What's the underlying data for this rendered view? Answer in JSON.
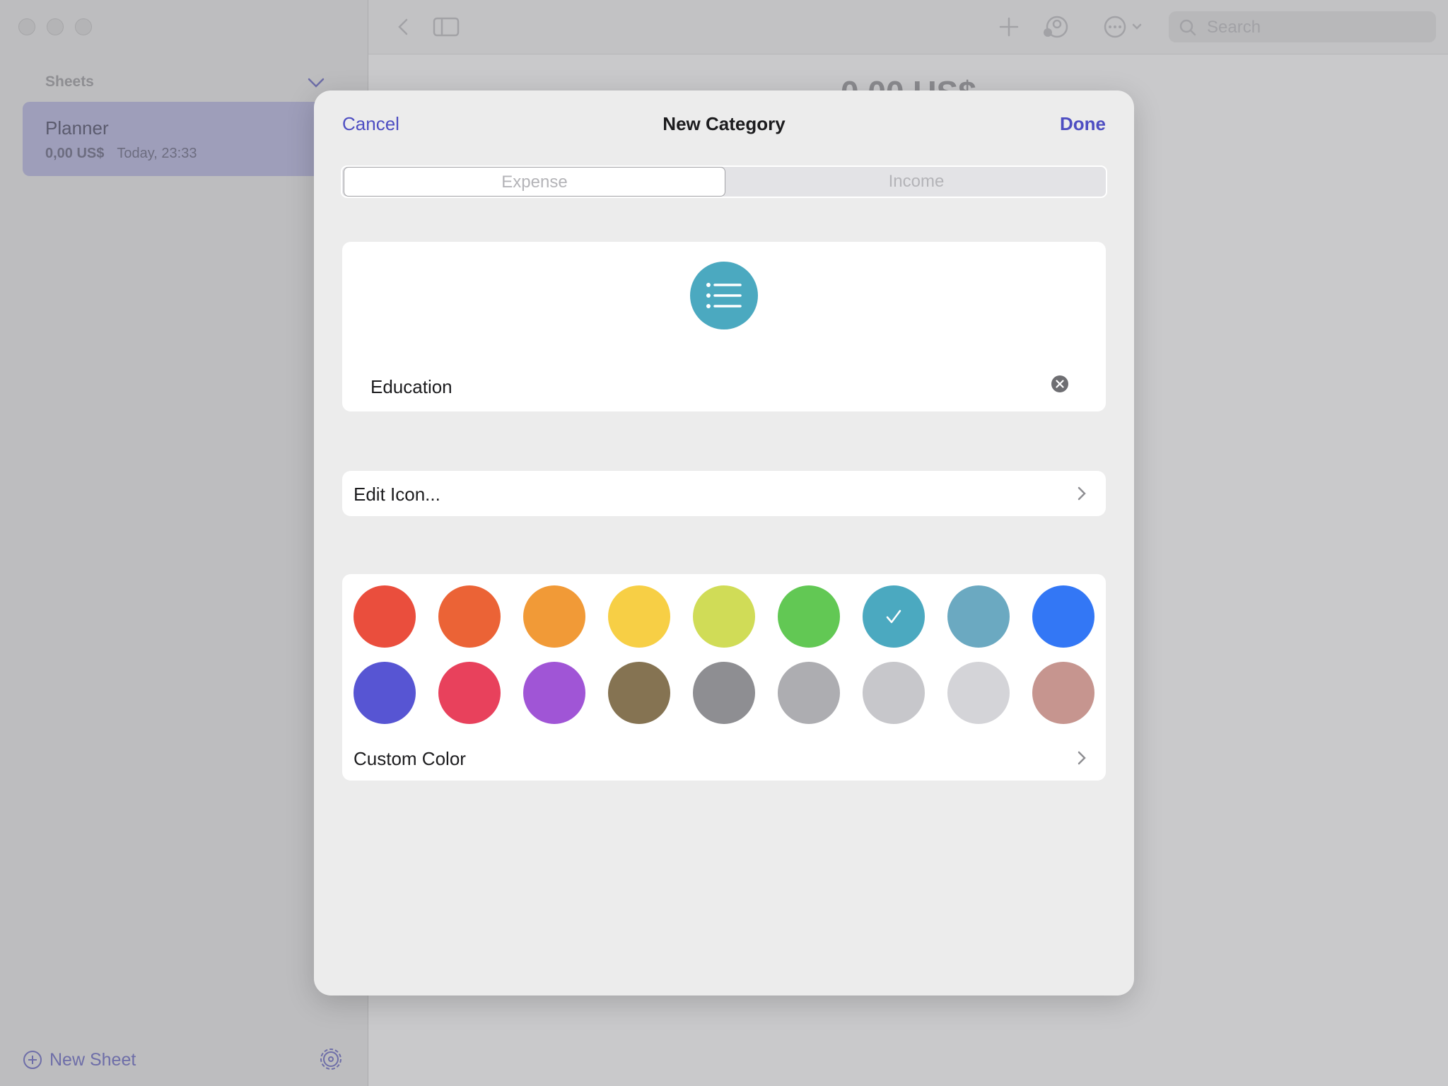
{
  "sidebar": {
    "header": "Sheets",
    "sheets": [
      {
        "title": "Planner",
        "amount": "0,00 US$",
        "date": "Today, 23:33"
      }
    ],
    "new_sheet_label": "New Sheet"
  },
  "toolbar": {
    "search_placeholder": "Search"
  },
  "main": {
    "amount_text": "0,00 US$"
  },
  "modal": {
    "cancel_label": "Cancel",
    "title": "New Category",
    "done_label": "Done",
    "segments": [
      {
        "label": "Expense",
        "selected": true
      },
      {
        "label": "Income",
        "selected": false
      }
    ],
    "icon_name": "list-bullet-icon",
    "category_name": "Education",
    "edit_icon_label": "Edit Icon...",
    "custom_color_label": "Custom Color",
    "colors": [
      {
        "hex": "#ea4e3d",
        "selected": false
      },
      {
        "hex": "#eb6336",
        "selected": false
      },
      {
        "hex": "#f19a37",
        "selected": false
      },
      {
        "hex": "#f7cf45",
        "selected": false
      },
      {
        "hex": "#d0dc57",
        "selected": false
      },
      {
        "hex": "#62c854",
        "selected": false
      },
      {
        "hex": "#4ba9c0",
        "selected": true
      },
      {
        "hex": "#6ba9c1",
        "selected": false
      },
      {
        "hex": "#3377f5",
        "selected": false
      },
      {
        "hex": "#5755d3",
        "selected": false
      },
      {
        "hex": "#e8415c",
        "selected": false
      },
      {
        "hex": "#a055d6",
        "selected": false
      },
      {
        "hex": "#857352",
        "selected": false
      },
      {
        "hex": "#8e8e92",
        "selected": false
      },
      {
        "hex": "#adadb1",
        "selected": false
      },
      {
        "hex": "#c7c7cb",
        "selected": false
      },
      {
        "hex": "#d4d4d8",
        "selected": false
      },
      {
        "hex": "#c6958f",
        "selected": false
      }
    ]
  },
  "accent_color": "#4e4ec2"
}
